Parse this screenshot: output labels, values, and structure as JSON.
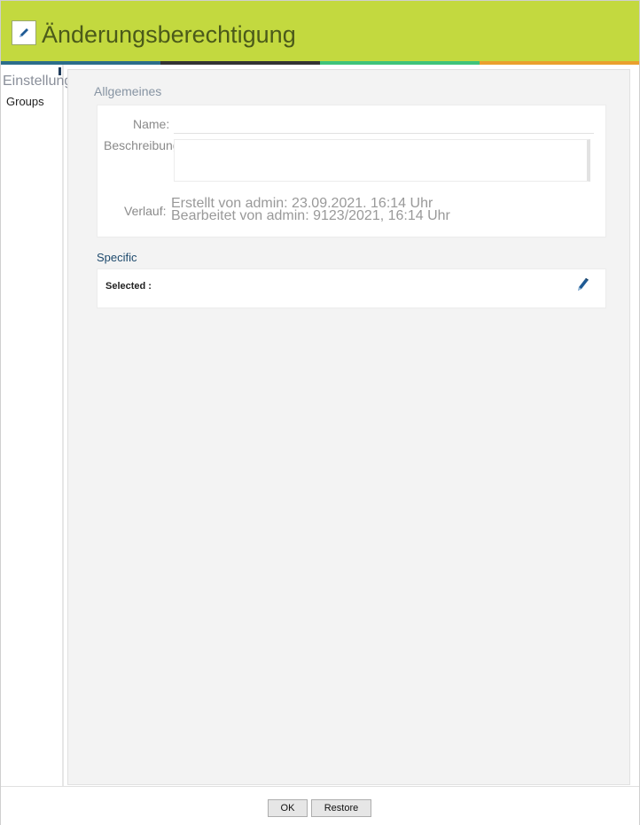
{
  "header": {
    "title": "Änderungsberechtigung",
    "icon": "pencil-icon"
  },
  "colors": {
    "header_bg": "#c3d93f",
    "stripes": [
      "#2c6e8a",
      "#333333",
      "#3fc37a",
      "#eaa02e"
    ]
  },
  "sidebar": {
    "title": "Einstellungen",
    "items": [
      {
        "label": "Groups"
      }
    ]
  },
  "general": {
    "title": "Allgemeines",
    "name_label": "Name:",
    "name_value": "",
    "description_label": "Beschreibung:",
    "description_value": "",
    "history_label": "Verlauf:",
    "created": "Erstellt von admin: 23.09.2021. 16:14 Uhr",
    "edited": "Bearbeitet von admin: 9123/2021, 16:14 Uhr"
  },
  "specific": {
    "title": "Specific",
    "selected_label": "Selected :",
    "edit_icon": "pencil-icon"
  },
  "footer": {
    "ok_label": "OK",
    "restore_label": "Restore"
  }
}
